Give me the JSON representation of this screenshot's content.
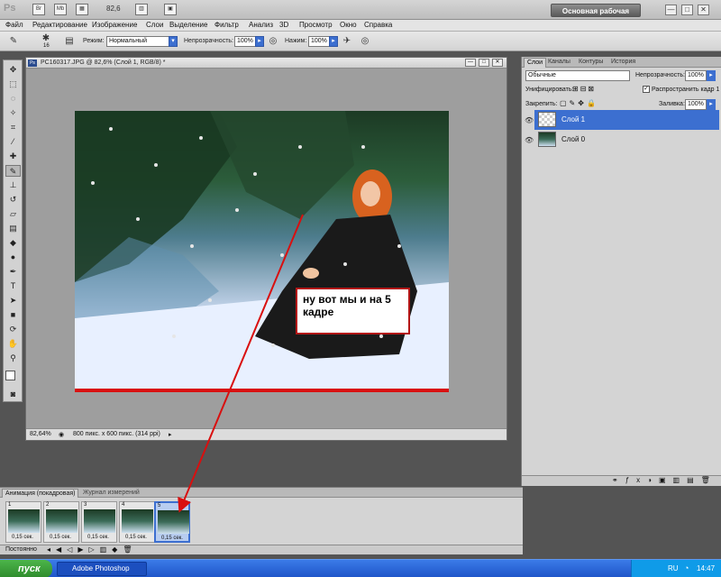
{
  "app": {
    "logo": "Ps",
    "zoom": "82,6",
    "workspace": "Основная рабочая среда",
    "window_controls": [
      "—",
      "□",
      "✕"
    ]
  },
  "menu": [
    "Файл",
    "Редактирование",
    "Изображение",
    "Слои",
    "Выделение",
    "Фильтр",
    "Анализ",
    "3D",
    "Просмотр",
    "Окно",
    "Справка"
  ],
  "options": {
    "mode_label": "Режим:",
    "mode_value": "Нормальный",
    "opacity_label": "Непрозрачность:",
    "opacity_value": "100%",
    "pressure_label": "Нажим:",
    "pressure_value": "100%",
    "brush_size": "16"
  },
  "document": {
    "title": "PC160317.JPG @ 82,6% (Слой 1, RGB/8) *",
    "zoom": "82,64%",
    "info": "800 пикс. x 600 пикс. (314 ppi)",
    "callout": "ну вот мы и на 5 кадре"
  },
  "layers_panel": {
    "tabs": [
      "Слои",
      "Каналы",
      "Контуры",
      "История"
    ],
    "blend_mode": "Обычные",
    "opacity_label": "Непрозрачность:",
    "opacity_value": "100%",
    "unify_label": "Унифицировать:",
    "propagate_label": "Распространить кадр 1",
    "lock_label": "Закрепить:",
    "fill_label": "Заливка:",
    "fill_value": "100%",
    "layers": [
      {
        "name": "Слой 1",
        "selected": true
      },
      {
        "name": "Слой 0",
        "selected": false
      }
    ]
  },
  "animation_panel": {
    "tabs": [
      "Анимация (покадровая)",
      "Журнал измерений"
    ],
    "frames": [
      {
        "number": "1",
        "duration": "0,15 сек."
      },
      {
        "number": "2",
        "duration": "0,15 сек."
      },
      {
        "number": "3",
        "duration": "0,15 сек."
      },
      {
        "number": "4",
        "duration": "0,15 сек."
      },
      {
        "number": "5",
        "duration": "0,15 сек."
      }
    ],
    "selected_frame": 5,
    "loop": "Постоянно"
  },
  "taskbar": {
    "start": "пуск",
    "item": "Adobe Photoshop CS...",
    "lang": "RU",
    "time": "14:47"
  },
  "colors": {
    "accent": "#3c6fd0",
    "red": "#d90f0f",
    "taskbar": "#2458d0"
  }
}
